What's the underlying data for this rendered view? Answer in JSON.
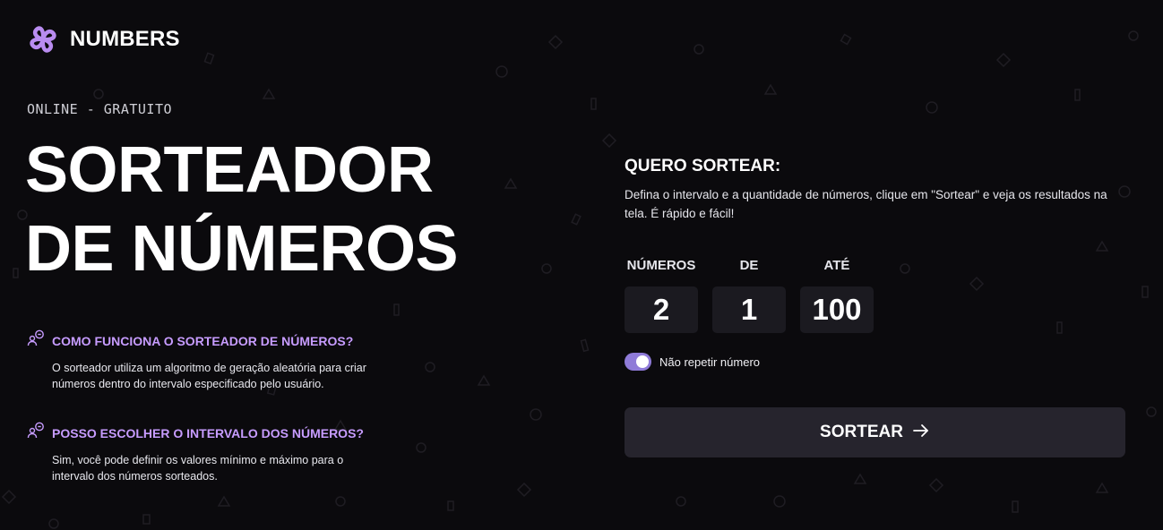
{
  "brand": {
    "name": "NUMBERS",
    "logo_icon": "purple-flower-logo",
    "accent": "#c79cff"
  },
  "hero": {
    "eyebrow": "ONLINE - GRATUITO",
    "title_line1": "SORTEADOR",
    "title_line2": "DE NÚMEROS"
  },
  "faq": [
    {
      "icon": "people-chat-icon",
      "question": "COMO FUNCIONA O SORTEADOR DE NÚMEROS?",
      "answer": "O sorteador utiliza um algoritmo de geração aleatória para criar números dentro do intervalo especificado pelo usuário."
    },
    {
      "icon": "people-chat-icon",
      "question": "POSSO ESCOLHER O INTERVALO DOS NÚMEROS?",
      "answer": "Sim, você pode definir os valores mínimo e máximo para o intervalo dos números sorteados."
    }
  ],
  "form": {
    "title": "QUERO SORTEAR:",
    "description": "Defina o intervalo e a quantidade de números, clique em \"Sortear\" e veja os resultados na tela. É rápido e fácil!",
    "fields": [
      {
        "label": "NÚMEROS",
        "value": "2"
      },
      {
        "label": "DE",
        "value": "1"
      },
      {
        "label": "ATÉ",
        "value": "100"
      }
    ],
    "no_repeat": {
      "label": "Não repetir número",
      "enabled": true,
      "color": "#8f7bd8"
    },
    "submit": {
      "label": "SORTEAR",
      "icon": "arrow-right-icon"
    }
  },
  "colors": {
    "background": "#0b0a0d",
    "input_bg": "#1b1a20",
    "button_bg": "#26242d"
  }
}
